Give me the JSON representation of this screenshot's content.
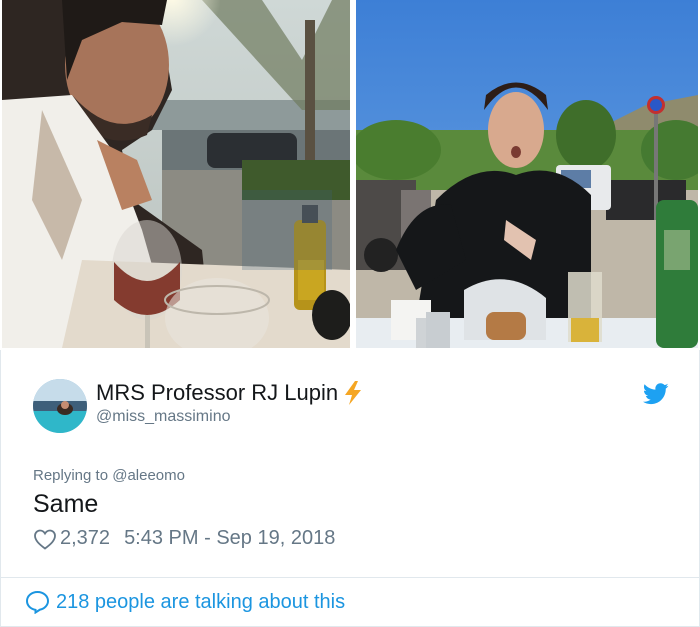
{
  "tweet": {
    "display_name": "MRS Professor RJ Lupin",
    "name_emoji": "lightning-icon",
    "handle": "@miss_massimino",
    "replying_to": "Replying to @aleeomo",
    "text": "Same",
    "likes": "2,372",
    "timestamp": "5:43 PM - Sep 19, 2018",
    "platform_icon": "twitter-bird-icon"
  },
  "footer": {
    "talking_text": "218 people are talking about this",
    "icon": "speech-bubble-icon"
  },
  "colors": {
    "link_blue": "#1b95e0",
    "twitter_blue": "#1da1f2",
    "muted_gray": "#657786",
    "text": "#14171a",
    "border": "#e1e8ed",
    "bolt": "#f5a623"
  }
}
